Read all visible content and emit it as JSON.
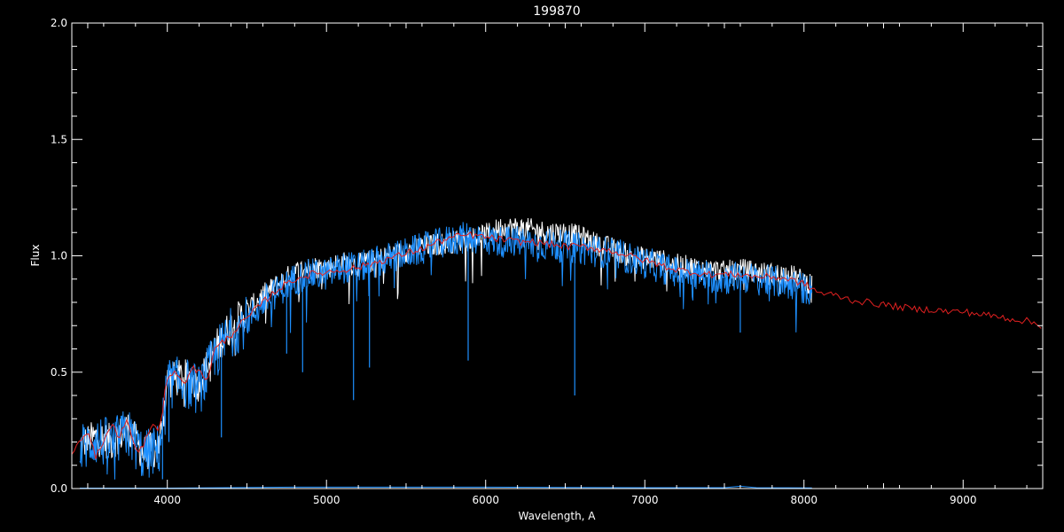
{
  "chart_data": {
    "type": "line",
    "title": "199870",
    "xlabel": "Wavelength, A",
    "ylabel": "Flux",
    "xlim": [
      3400,
      9500
    ],
    "ylim": [
      0.0,
      2.0
    ],
    "xticks": [
      {
        "value": 4000,
        "label": "4000"
      },
      {
        "value": 5000,
        "label": "5000"
      },
      {
        "value": 6000,
        "label": "6000"
      },
      {
        "value": 7000,
        "label": "7000"
      },
      {
        "value": 8000,
        "label": "8000"
      },
      {
        "value": 9000,
        "label": "9000"
      }
    ],
    "yticks": [
      {
        "value": 0.0,
        "label": "0.0"
      },
      {
        "value": 0.5,
        "label": "0.5"
      },
      {
        "value": 1.0,
        "label": "1.0"
      },
      {
        "value": 1.5,
        "label": "1.5"
      },
      {
        "value": 2.0,
        "label": "2.0"
      }
    ],
    "colors": {
      "background": "#000000",
      "axes": "#ffffff",
      "white_spectrum": "#ffffff",
      "blue_spectrum": "#1e90ff",
      "red_model": "#e02020"
    },
    "series": [
      {
        "color": "#ffffff",
        "style": "spectrum",
        "x": [
          3450,
          3550,
          3650,
          3750,
          3850,
          3950,
          4000,
          4100,
          4200,
          4300,
          4400,
          4500,
          4600,
          4700,
          4800,
          4900,
          5000,
          5100,
          5200,
          5300,
          5400,
          5500,
          5600,
          5700,
          5800,
          5900,
          6000,
          6100,
          6200,
          6300,
          6400,
          6500,
          6600,
          6700,
          6800,
          6900,
          7000,
          7100,
          7200,
          7300,
          7400,
          7500,
          7600,
          7700,
          7800,
          7900,
          8000,
          8050
        ],
        "y": [
          0.18,
          0.22,
          0.2,
          0.26,
          0.15,
          0.18,
          0.46,
          0.48,
          0.45,
          0.6,
          0.7,
          0.76,
          0.83,
          0.88,
          0.93,
          0.95,
          0.95,
          0.97,
          0.96,
          0.98,
          1.0,
          1.02,
          1.04,
          1.05,
          1.06,
          1.08,
          1.09,
          1.12,
          1.12,
          1.11,
          1.1,
          1.1,
          1.08,
          1.05,
          1.03,
          1.0,
          0.99,
          0.98,
          0.96,
          0.95,
          0.94,
          0.93,
          0.94,
          0.93,
          0.92,
          0.92,
          0.89,
          0.88
        ]
      },
      {
        "color": "#1e90ff",
        "style": "spectrum",
        "x": [
          3450,
          3550,
          3650,
          3750,
          3850,
          3950,
          4000,
          4100,
          4200,
          4300,
          4400,
          4500,
          4600,
          4700,
          4800,
          4900,
          5000,
          5100,
          5200,
          5300,
          5400,
          5500,
          5600,
          5700,
          5800,
          5900,
          6000,
          6100,
          6200,
          6300,
          6400,
          6500,
          6600,
          6700,
          6800,
          6900,
          7000,
          7100,
          7200,
          7300,
          7400,
          7500,
          7600,
          7700,
          7800,
          7900,
          8000,
          8050
        ],
        "y": [
          0.17,
          0.21,
          0.19,
          0.24,
          0.14,
          0.17,
          0.45,
          0.46,
          0.42,
          0.57,
          0.67,
          0.72,
          0.8,
          0.85,
          0.9,
          0.92,
          0.92,
          0.95,
          0.95,
          0.97,
          0.99,
          1.01,
          1.03,
          1.05,
          1.07,
          1.08,
          1.07,
          1.06,
          1.06,
          1.05,
          1.05,
          1.04,
          1.03,
          1.02,
          1.01,
          0.99,
          0.97,
          0.95,
          0.93,
          0.92,
          0.91,
          0.9,
          0.91,
          0.9,
          0.89,
          0.88,
          0.86,
          0.85
        ]
      },
      {
        "color": "#e02020",
        "style": "model",
        "x": [
          3400,
          3450,
          3500,
          3550,
          3600,
          3650,
          3700,
          3750,
          3800,
          3850,
          3900,
          3950,
          4000,
          4050,
          4100,
          4150,
          4200,
          4250,
          4300,
          4350,
          4400,
          4450,
          4500,
          4600,
          4700,
          4800,
          4900,
          5000,
          5100,
          5200,
          5300,
          5400,
          5500,
          5600,
          5700,
          5800,
          5900,
          6000,
          6100,
          6200,
          6300,
          6400,
          6500,
          6600,
          6700,
          6800,
          6900,
          7000,
          7100,
          7200,
          7300,
          7400,
          7500,
          7600,
          7700,
          7800,
          7900,
          8000,
          8100,
          8200,
          8300,
          8400,
          8500,
          8600,
          8700,
          8800,
          8900,
          9000,
          9100,
          9200,
          9300,
          9400,
          9500
        ],
        "y": [
          0.16,
          0.2,
          0.24,
          0.14,
          0.19,
          0.28,
          0.22,
          0.3,
          0.16,
          0.18,
          0.28,
          0.24,
          0.48,
          0.51,
          0.44,
          0.52,
          0.5,
          0.47,
          0.6,
          0.63,
          0.66,
          0.7,
          0.73,
          0.8,
          0.86,
          0.9,
          0.92,
          0.93,
          0.94,
          0.95,
          0.97,
          0.99,
          1.01,
          1.03,
          1.06,
          1.08,
          1.09,
          1.08,
          1.07,
          1.06,
          1.06,
          1.05,
          1.04,
          1.04,
          1.03,
          1.02,
          1.0,
          0.98,
          0.96,
          0.94,
          0.93,
          0.92,
          0.92,
          0.92,
          0.91,
          0.91,
          0.9,
          0.88,
          0.84,
          0.83,
          0.81,
          0.8,
          0.79,
          0.78,
          0.77,
          0.77,
          0.76,
          0.76,
          0.75,
          0.74,
          0.73,
          0.72,
          0.7
        ]
      },
      {
        "color": "#1e90ff",
        "style": "error",
        "x": [
          3450,
          4000,
          4800,
          5500,
          6000,
          6500,
          7000,
          7500,
          7600,
          7700,
          8050
        ],
        "y": [
          0.002,
          0.002,
          0.006,
          0.006,
          0.006,
          0.005,
          0.004,
          0.004,
          0.01,
          0.004,
          0.003
        ]
      }
    ],
    "absorption_features": [
      {
        "x": 3970,
        "y": 0.04
      },
      {
        "x": 4010,
        "y": 0.2
      },
      {
        "x": 4340,
        "y": 0.22
      },
      {
        "x": 4750,
        "y": 0.58
      },
      {
        "x": 4850,
        "y": 0.5
      },
      {
        "x": 5170,
        "y": 0.38
      },
      {
        "x": 5270,
        "y": 0.52
      },
      {
        "x": 5890,
        "y": 0.55
      },
      {
        "x": 6560,
        "y": 0.4
      },
      {
        "x": 7600,
        "y": 0.67
      }
    ]
  }
}
